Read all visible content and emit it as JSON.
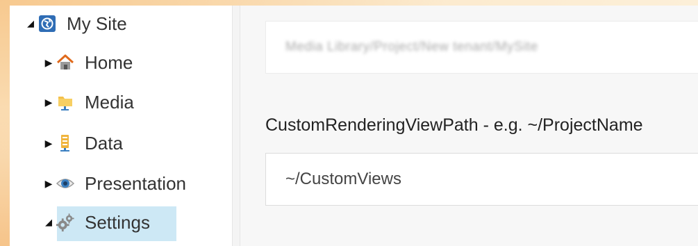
{
  "tree": {
    "root": {
      "label": "My Site",
      "icon": "globe-icon",
      "expanded": true
    },
    "items": [
      {
        "label": "Home",
        "icon": "house-icon",
        "expanded": false
      },
      {
        "label": "Media",
        "icon": "media-folder-icon",
        "expanded": false
      },
      {
        "label": "Data",
        "icon": "data-icon",
        "expanded": false
      },
      {
        "label": "Presentation",
        "icon": "eye-icon",
        "expanded": false
      },
      {
        "label": "Settings",
        "icon": "gears-icon",
        "expanded": true,
        "selected": true
      }
    ]
  },
  "form": {
    "path_value": "Media Library/Project/New tenant/MySite",
    "field_label": "CustomRenderingViewPath - e.g. ~/ProjectName",
    "field_value": "~/CustomViews"
  },
  "colors": {
    "selected_bg": "#cde8f5",
    "accent_blue": "#3a7fc1"
  }
}
